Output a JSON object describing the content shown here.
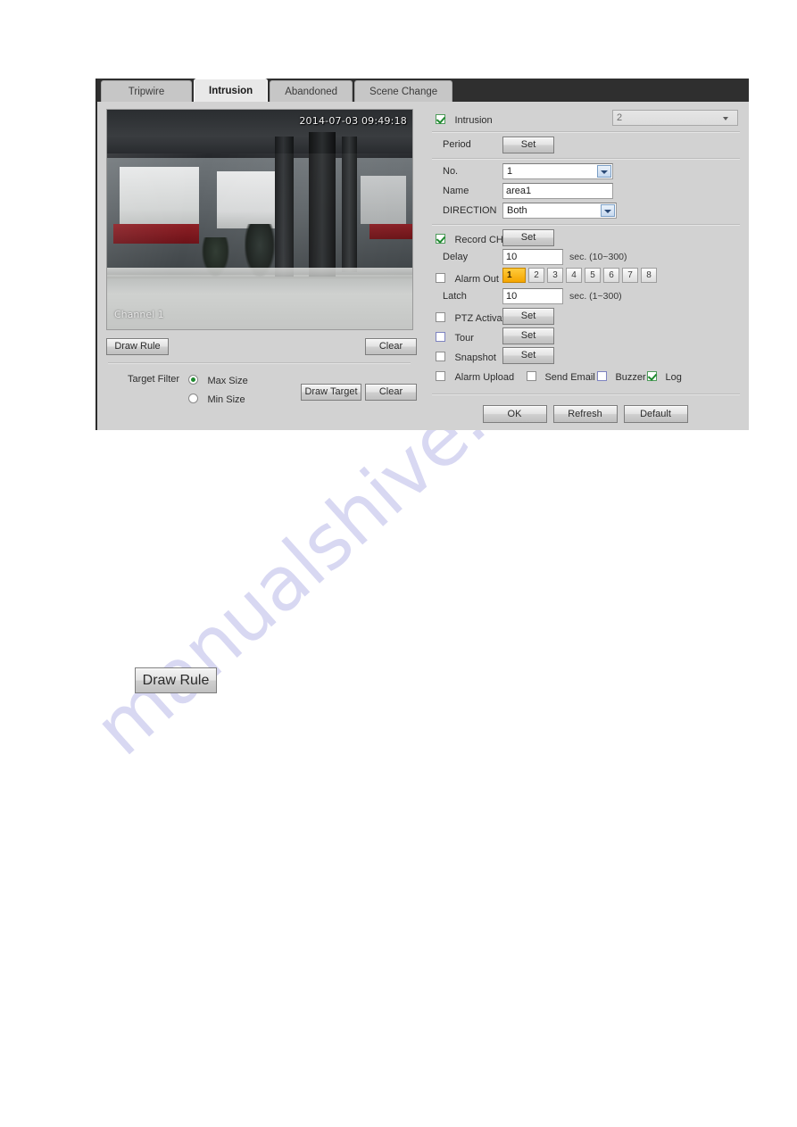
{
  "watermark": {
    "text": "manualshive.com"
  },
  "tabs": [
    {
      "label": "Tripwire",
      "active": false
    },
    {
      "label": "Intrusion",
      "active": true
    },
    {
      "label": "Abandoned",
      "active": false
    },
    {
      "label": "Scene Change",
      "active": false
    }
  ],
  "preview": {
    "timestamp": "2014-07-03 09:49:18",
    "channel_label": "Channel 1"
  },
  "left_panel": {
    "draw_rule_button": "Draw Rule",
    "clear_button": "Clear",
    "target_filter_label": "Target Filter",
    "max_size_label": "Max Size",
    "min_size_label": "Min Size",
    "max_size_selected": true,
    "min_size_selected": false,
    "draw_target_button": "Draw Target",
    "clear_target_button": "Clear"
  },
  "right_panel": {
    "enable": {
      "label": "Intrusion",
      "checked": true
    },
    "channel": {
      "value": "2"
    },
    "period": {
      "label": "Period",
      "set_button": "Set"
    },
    "no": {
      "label": "No.",
      "value": "1"
    },
    "name": {
      "label": "Name",
      "value": "area1"
    },
    "direction": {
      "label": "DIRECTION",
      "value": "Both"
    },
    "record_ch": {
      "label": "Record CH",
      "checked": true,
      "set_button": "Set"
    },
    "delay": {
      "label": "Delay",
      "value": "10",
      "unit": "sec. (10~300)"
    },
    "alarm_out": {
      "label": "Alarm Out",
      "checked": false,
      "channels": [
        "1",
        "2",
        "3",
        "4",
        "5",
        "6",
        "7",
        "8"
      ],
      "selected": "1"
    },
    "latch": {
      "label": "Latch",
      "value": "10",
      "unit": "sec. (1~300)"
    },
    "ptz_activation": {
      "label": "PTZ Activation",
      "checked": false,
      "set_button": "Set"
    },
    "tour": {
      "label": "Tour",
      "checked": false,
      "set_button": "Set"
    },
    "snapshot": {
      "label": "Snapshot",
      "checked": false,
      "set_button": "Set"
    },
    "alarm_upload": {
      "label": "Alarm Upload",
      "checked": false
    },
    "send_email": {
      "label": "Send Email",
      "checked": false
    },
    "buzzer": {
      "label": "Buzzer",
      "checked": false
    },
    "log": {
      "label": "Log",
      "checked": true
    },
    "footer": {
      "ok": "OK",
      "refresh": "Refresh",
      "default": "Default"
    }
  },
  "standalone_button": {
    "label": "Draw Rule"
  },
  "colors": {
    "accent_orange": "#f5a500",
    "check_green": "#1f8a30",
    "tabbar_dark": "#2f2f2f",
    "dialog_bg": "#d2d2d2",
    "watermark": "#d8d8f2"
  }
}
